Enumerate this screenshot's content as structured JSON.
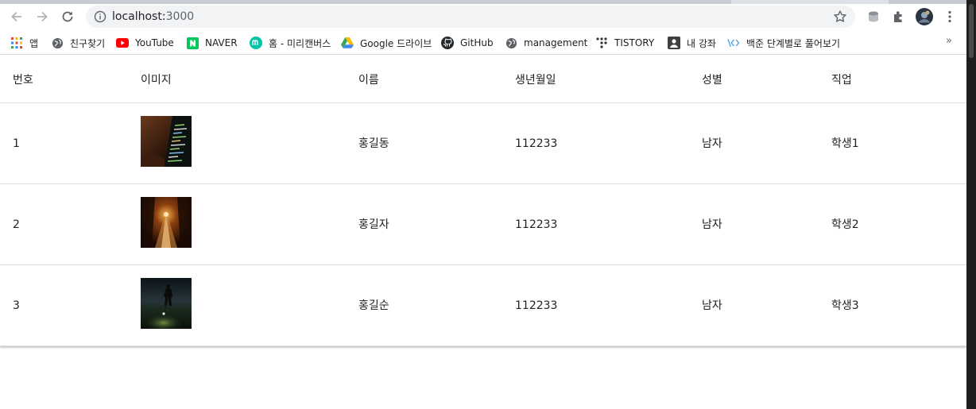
{
  "browser": {
    "url_host": "localhost:",
    "url_port": "3000",
    "back_label": "Back",
    "forward_label": "Forward",
    "reload_label": "Reload"
  },
  "bookmarks": [
    {
      "label": "앱",
      "icon": "apps-grid-icon"
    },
    {
      "label": "친구찾기",
      "icon": "globe-icon"
    },
    {
      "label": "YouTube",
      "icon": "youtube-icon"
    },
    {
      "label": "NAVER",
      "icon": "naver-icon"
    },
    {
      "label": "홈 - 미리캔버스",
      "icon": "miricanvas-icon"
    },
    {
      "label": "Google 드라이브",
      "icon": "google-drive-icon"
    },
    {
      "label": "GitHub",
      "icon": "github-icon"
    },
    {
      "label": "management",
      "icon": "globe-icon"
    },
    {
      "label": "TISTORY",
      "icon": "tistory-icon"
    },
    {
      "label": "내 강좌",
      "icon": "person-card-icon"
    },
    {
      "label": "백준 단계별로 풀어보기",
      "icon": "code-brackets-icon"
    }
  ],
  "bookmarks_more": "»",
  "table": {
    "headers": [
      "번호",
      "이미지",
      "이름",
      "생년월일",
      "성별",
      "직업"
    ],
    "rows": [
      {
        "id": "1",
        "image": "code-screen-photo",
        "name": "홍길동",
        "birthday": "112233",
        "gender": "남자",
        "job": "학생1"
      },
      {
        "id": "2",
        "image": "forest-path-photo",
        "name": "홍길자",
        "birthday": "112233",
        "gender": "남자",
        "job": "학생2"
      },
      {
        "id": "3",
        "image": "golfer-night-photo",
        "name": "홍길순",
        "birthday": "112233",
        "gender": "남자",
        "job": "학생3"
      }
    ]
  },
  "colors": {
    "youtube": "#ff0000",
    "naver": "#03c75a",
    "miricanvas": "#00c4a7",
    "link_blue": "#4b9bd6"
  }
}
